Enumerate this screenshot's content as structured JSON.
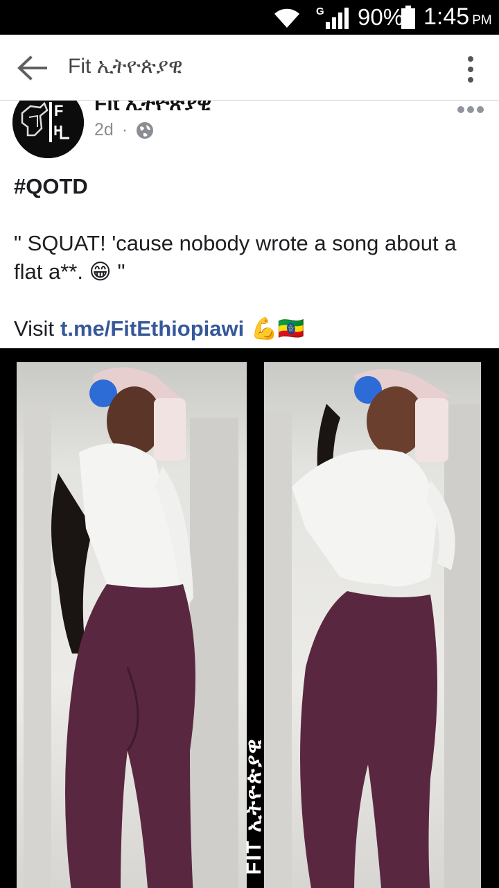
{
  "status_bar": {
    "network_type": "G",
    "battery_percent": "90%",
    "time": "1:45",
    "time_suffix": "PM"
  },
  "app_bar": {
    "title": "Fit ኢትዮጵያዊ"
  },
  "post": {
    "page_name": "Fit ኢትዮጵያዊ",
    "age": "2d",
    "separator": "·",
    "privacy_icon": "globe-icon",
    "hashtag": "#QOTD",
    "quote": "\" SQUAT! 'cause nobody wrote a song about a flat a**. 😁 \"",
    "visit_label": "Visit",
    "visit_link": "t.me/FitEthiopiawi",
    "visit_emojis": "💪🇪🇹"
  },
  "photo": {
    "watermark": "FIT ኢትዮጵያዊ"
  },
  "colors": {
    "link": "#365899",
    "meta": "#8a8d91",
    "status_bar": "#000000"
  }
}
